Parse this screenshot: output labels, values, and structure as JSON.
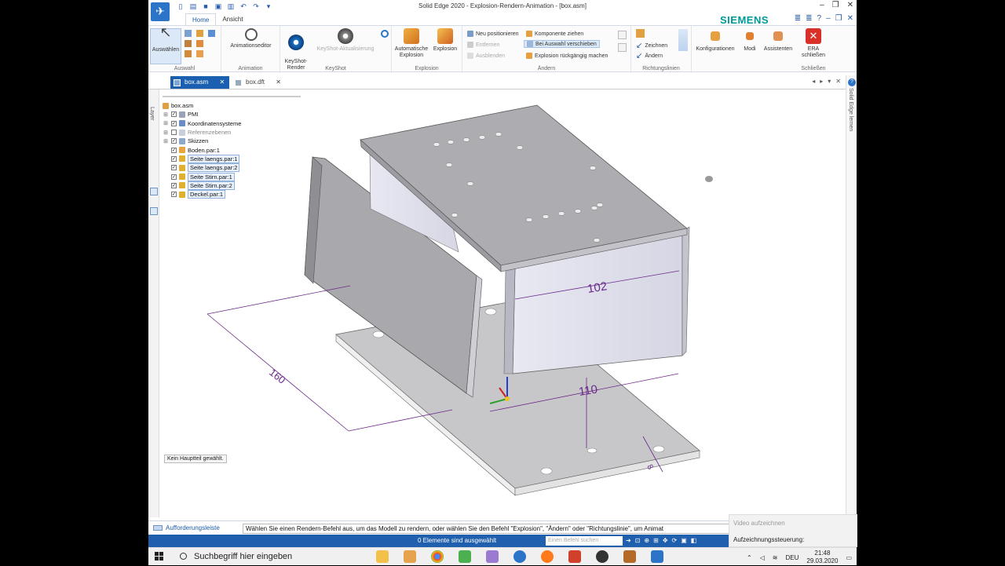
{
  "window": {
    "title": "Solid Edge 2020 - Explosion-Rendern-Animation - [box.asm]",
    "brand": "SIEMENS"
  },
  "tabs": [
    {
      "label": "Home",
      "active": true
    },
    {
      "label": "Ansicht",
      "active": false
    }
  ],
  "ribbon": {
    "auswahl": {
      "button": "Auswählen",
      "group": "Auswahl"
    },
    "animation": {
      "button": "Animationseditor",
      "group": "Animation"
    },
    "keyshot": {
      "render": "KeyShot-\nRender",
      "update": "KeyShot-Aktualisierung",
      "group": "KeyShot"
    },
    "explosion": {
      "auto": "Automatische Explosion",
      "explosion": "Explosion",
      "group": "Explosion"
    },
    "aendern": {
      "neu_positionieren": "Neu positionieren",
      "entfernen": "Entfernen",
      "ausblenden": "Ausblenden",
      "komponente_ziehen": "Komponente ziehen",
      "bei_auswahl": "Bei Auswahl verschieben",
      "rueckgaengig": "Explosion rückgängig machen",
      "group": "Ändern"
    },
    "richtungslinien": {
      "zeichnen": "Zeichnen",
      "aendern": "Ändern",
      "group": "Richtungslinien"
    },
    "konfigurationen": "Konfigurationen",
    "modi": "Modi",
    "assistenten": "Assistenten",
    "era": {
      "button": "ERA schließen",
      "group": "Schließen"
    }
  },
  "doc_tabs": [
    {
      "label": "box.asm",
      "active": true
    },
    {
      "label": "box.dft",
      "active": false
    }
  ],
  "left_strip": "Layer",
  "right_strip": "Solid Edge lernen",
  "tree": {
    "root": "box.asm",
    "items": [
      {
        "label": "PMI",
        "checked": true
      },
      {
        "label": "Koordinatensysteme",
        "checked": true
      },
      {
        "label": "Referenzebenen",
        "checked": false
      },
      {
        "label": "Skizzen",
        "checked": true
      },
      {
        "label": "Boden.par:1",
        "checked": true
      },
      {
        "label": "Seite laengs.par:1",
        "checked": true
      },
      {
        "label": "Seite laengs.par:2",
        "checked": true
      },
      {
        "label": "Seite Stirn.par:1",
        "checked": true
      },
      {
        "label": "Seite Stirn.par:2",
        "checked": true
      },
      {
        "label": "Deckel.par:1",
        "checked": true
      }
    ]
  },
  "model": {
    "dims": [
      "102",
      "160",
      "110",
      "8"
    ]
  },
  "main_part_note": "Kein Hauptteil gewählt.",
  "prompt": {
    "label": "Aufforderungsleiste",
    "message": "Wählen Sie einen Rendern-Befehl aus, um das Modell zu rendern, oder wählen Sie den Befehl \"Explosion\", \"Ändern\" oder \"Richtungslinie\", um Animat"
  },
  "status": {
    "selection": "0 Elemente sind ausgewählt",
    "command_placeholder": "Einen Befehl suchen"
  },
  "recorder": {
    "record": "Video aufzeichnen",
    "control": "Aufzeichnungssteuerung:"
  },
  "taskbar": {
    "search": "Suchbegriff hier eingeben",
    "lang": "DEU",
    "time": "21:48",
    "date": "29.03.2020"
  }
}
